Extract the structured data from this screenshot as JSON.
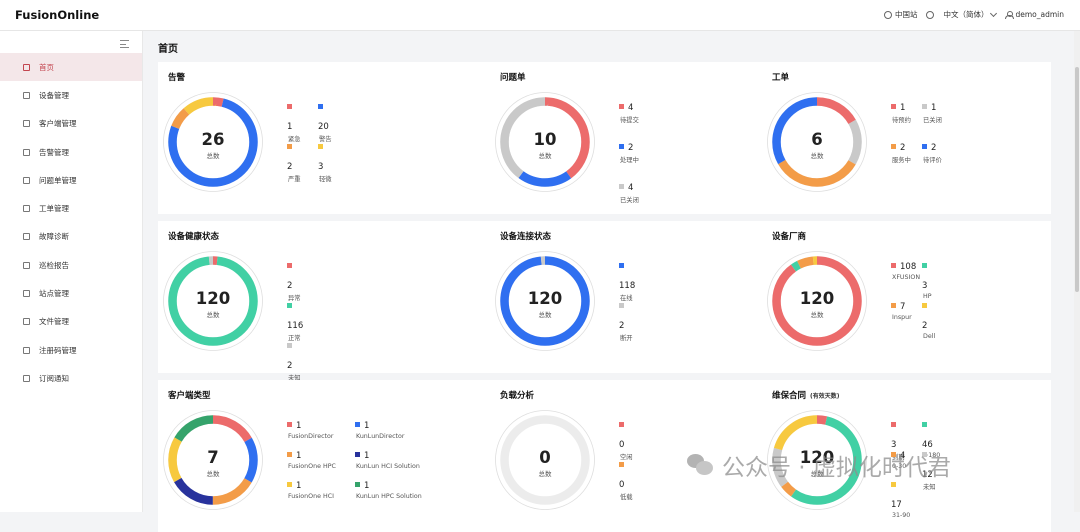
{
  "app": {
    "title": "FusionOnline"
  },
  "header": {
    "site": "中国站",
    "language": "中文（简体）",
    "user": "demo_admin"
  },
  "sidebar": {
    "items": [
      {
        "label": "首页",
        "icon": "home-icon",
        "active": true
      },
      {
        "label": "设备管理",
        "icon": "device-icon"
      },
      {
        "label": "客户端管理",
        "icon": "client-icon"
      },
      {
        "label": "告警管理",
        "icon": "bell-icon"
      },
      {
        "label": "问题单管理",
        "icon": "ticket-icon"
      },
      {
        "label": "工单管理",
        "icon": "workorder-icon"
      },
      {
        "label": "故障诊断",
        "icon": "diagnosis-icon"
      },
      {
        "label": "巡检报告",
        "icon": "report-icon"
      },
      {
        "label": "站点管理",
        "icon": "site-icon"
      },
      {
        "label": "文件管理",
        "icon": "file-icon"
      },
      {
        "label": "注册码管理",
        "icon": "license-icon"
      },
      {
        "label": "订阅通知",
        "icon": "subscribe-icon"
      }
    ]
  },
  "page": {
    "title": "首页"
  },
  "colors": {
    "red": "#ec6b6b",
    "blue": "#2f6ff0",
    "orange": "#f39c48",
    "yellow": "#f7c93f",
    "gray": "#c9c9c9",
    "teal": "#41d0a4",
    "navy": "#28329c",
    "green": "#35a36b"
  },
  "panels": [
    {
      "title": "告警",
      "subtitle": "",
      "total": "26",
      "total_label": "总数",
      "cols": 2,
      "segments": [
        {
          "label": "紧急",
          "value": 1,
          "color": "#ec6b6b"
        },
        {
          "label": "警告",
          "value": 20,
          "color": "#2f6ff0"
        },
        {
          "label": "严重",
          "value": 2,
          "color": "#f39c48"
        },
        {
          "label": "轻微",
          "value": 3,
          "color": "#f7c93f"
        }
      ]
    },
    {
      "title": "问题单",
      "subtitle": "",
      "total": "10",
      "total_label": "总数",
      "cols": 1,
      "segments": [
        {
          "label": "待提交",
          "value": 4,
          "color": "#ec6b6b"
        },
        {
          "label": "处理中",
          "value": 2,
          "color": "#2f6ff0"
        },
        {
          "label": "已关闭",
          "value": 4,
          "color": "#c9c9c9"
        }
      ]
    },
    {
      "title": "工单",
      "subtitle": "",
      "total": "6",
      "total_label": "总数",
      "cols": 2,
      "segments": [
        {
          "label": "待预约",
          "value": 1,
          "color": "#ec6b6b"
        },
        {
          "label": "已关闭",
          "value": 1,
          "color": "#c9c9c9"
        },
        {
          "label": "服务中",
          "value": 2,
          "color": "#f39c48"
        },
        {
          "label": "待评价",
          "value": 2,
          "color": "#2f6ff0"
        }
      ]
    },
    {
      "title": "设备健康状态",
      "subtitle": "",
      "total": "120",
      "total_label": "总数",
      "cols": 1,
      "segments": [
        {
          "label": "异常",
          "value": 2,
          "color": "#ec6b6b"
        },
        {
          "label": "正常",
          "value": 116,
          "color": "#41d0a4"
        },
        {
          "label": "未知",
          "value": 2,
          "color": "#c9c9c9"
        }
      ]
    },
    {
      "title": "设备连接状态",
      "subtitle": "",
      "total": "120",
      "total_label": "总数",
      "cols": 1,
      "segments": [
        {
          "label": "在线",
          "value": 118,
          "color": "#2f6ff0"
        },
        {
          "label": "断开",
          "value": 2,
          "color": "#c9c9c9"
        }
      ]
    },
    {
      "title": "设备厂商",
      "subtitle": "",
      "total": "120",
      "total_label": "总数",
      "cols": 2,
      "segments": [
        {
          "label": "XFUSION",
          "value": 108,
          "color": "#ec6b6b"
        },
        {
          "label": "HP",
          "value": 3,
          "color": "#41d0a4"
        },
        {
          "label": "Inspur",
          "value": 7,
          "color": "#f39c48"
        },
        {
          "label": "Dell",
          "value": 2,
          "color": "#f7c93f"
        }
      ]
    },
    {
      "title": "客户端类型",
      "subtitle": "",
      "total": "7",
      "total_label": "总数",
      "cols": 2,
      "segments": [
        {
          "label": "FusionDirector",
          "value": 1,
          "color": "#ec6b6b"
        },
        {
          "label": "KunLunDirector",
          "value": 1,
          "color": "#2f6ff0"
        },
        {
          "label": "FusionOne HPC",
          "value": 1,
          "color": "#f39c48"
        },
        {
          "label": "KunLun HCI Solution",
          "value": 1,
          "color": "#28329c"
        },
        {
          "label": "FusionOne HCI",
          "value": 1,
          "color": "#f7c93f"
        },
        {
          "label": "KunLun HPC Solution",
          "value": 1,
          "color": "#35a36b"
        }
      ]
    },
    {
      "title": "负载分析",
      "subtitle": "",
      "total": "0",
      "total_label": "总数",
      "cols": 1,
      "segments": [
        {
          "label": "空闲",
          "value": 0,
          "color": "#ec6b6b"
        },
        {
          "label": "低载",
          "value": 0,
          "color": "#f39c48"
        }
      ]
    },
    {
      "title": "维保合同",
      "subtitle": "(有效天数)",
      "total": "120",
      "total_label": "总数",
      "cols": 2,
      "segments": [
        {
          "label": "到期",
          "value": 3,
          "color": "#ec6b6b"
        },
        {
          "label": ">180",
          "value": 46,
          "color": "#41d0a4"
        },
        {
          "label": "0-30",
          "value": 4,
          "color": "#f39c48"
        },
        {
          "label": "未知",
          "value": 12,
          "color": "#c9c9c9"
        },
        {
          "label": "31-90",
          "value": 17,
          "color": "#f7c93f"
        }
      ]
    }
  ],
  "watermark": {
    "text": "公众号 · 虚拟化时代君"
  }
}
